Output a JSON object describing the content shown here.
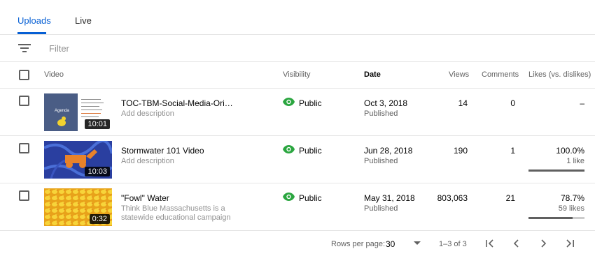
{
  "tabs": [
    {
      "label": "Uploads",
      "active": true
    },
    {
      "label": "Live",
      "active": false
    }
  ],
  "filter": {
    "placeholder": "Filter",
    "icon": "filter-icon"
  },
  "columns": {
    "video": "Video",
    "visibility": "Visibility",
    "date": "Date",
    "views": "Views",
    "comments": "Comments",
    "likes": "Likes (vs. dislikes)"
  },
  "rows": [
    {
      "title": "TOC-TBM-Social-Media-Orientati…",
      "description": "Add description",
      "duration": "10:01",
      "visibility": "Public",
      "date": "Oct 3, 2018",
      "status": "Published",
      "views": "14",
      "comments": "0",
      "likes": "–",
      "likes_sub": "",
      "like_ratio": null,
      "thumb_text": "Agenda"
    },
    {
      "title": "Stormwater 101 Video",
      "description": "Add description",
      "duration": "10:03",
      "visibility": "Public",
      "date": "Jun 28, 2018",
      "status": "Published",
      "views": "190",
      "comments": "1",
      "likes": "100.0%",
      "likes_sub": "1 like",
      "like_ratio": 1.0
    },
    {
      "title": "\"Fowl\" Water",
      "description": "Think Blue Massachusetts is a statewide educational campaign to…",
      "duration": "0:32",
      "visibility": "Public",
      "date": "May 31, 2018",
      "status": "Published",
      "views": "803,063",
      "comments": "21",
      "likes": "78.7%",
      "likes_sub": "59 likes",
      "like_ratio": 0.787
    }
  ],
  "footer": {
    "rows_per_page_label": "Rows per page:",
    "rows_per_page_value": "30",
    "range": "1–3 of 3"
  },
  "colors": {
    "accent": "#065fd4",
    "public_eye": "#2ba640"
  }
}
